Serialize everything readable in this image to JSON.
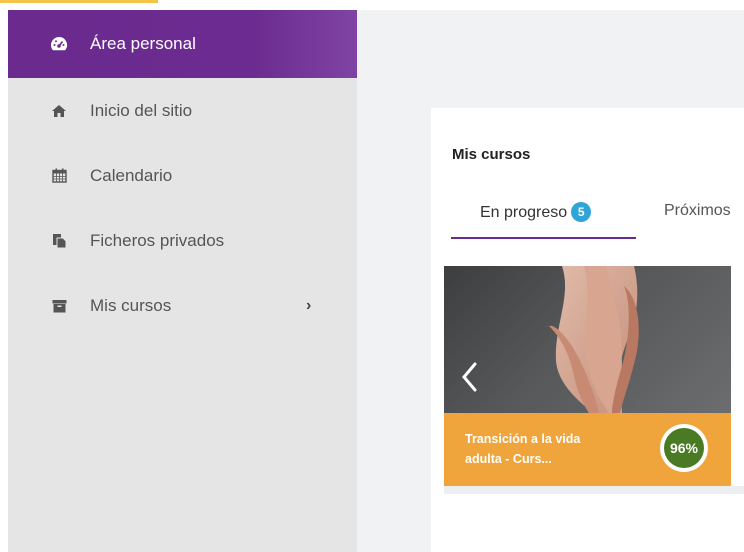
{
  "sidebar": {
    "items": [
      {
        "label": "Área personal",
        "icon": "dashboard-icon",
        "active": true
      },
      {
        "label": "Inicio del sitio",
        "icon": "home-icon"
      },
      {
        "label": "Calendario",
        "icon": "calendar-icon"
      },
      {
        "label": "Ficheros privados",
        "icon": "files-icon"
      },
      {
        "label": "Mis cursos",
        "icon": "archive-icon",
        "has_submenu": true
      }
    ]
  },
  "main": {
    "title": "Mis cursos",
    "tabs": [
      {
        "label": "En progreso",
        "count": "5",
        "active": true
      },
      {
        "label": "Próximos"
      }
    ],
    "course": {
      "name": "Transición a la vida adulta - Curs...",
      "progress": "96%",
      "progress_value": 0.96
    }
  },
  "colors": {
    "accent": "#6a2a8e",
    "badge": "#2fa4d8",
    "course_footer": "#f0a43c",
    "progress": "#4a7a23"
  }
}
